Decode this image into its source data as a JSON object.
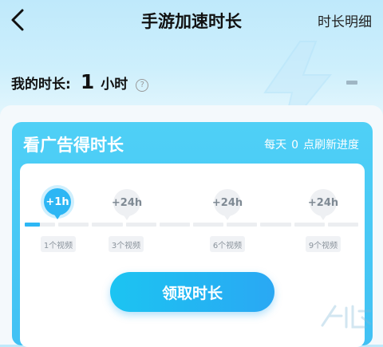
{
  "header": {
    "back_icon": "chevron-left-icon",
    "title": "手游加速时长",
    "detail_link": "时长明细"
  },
  "my_time": {
    "label": "我的时长:",
    "value": "1",
    "unit": "小时",
    "help_icon": "question-circle-icon",
    "help_glyph": "?"
  },
  "ad_card": {
    "title": "看广告得时长",
    "refresh_prefix": "每天",
    "refresh_count": "0",
    "refresh_suffix": "点刷新进度",
    "progress_fraction": 0.05,
    "milestones": [
      {
        "reward": "+1h",
        "requirement": "1个视频",
        "active": true
      },
      {
        "reward": "+24h",
        "requirement": "3个视频",
        "active": false
      },
      {
        "reward": "+24h",
        "requirement": "6个视频",
        "active": false
      },
      {
        "reward": "+24h",
        "requirement": "9个视频",
        "active": false
      }
    ],
    "claim_button": "领取时长"
  },
  "colors": {
    "accent": "#2cb6f4",
    "card_gradient_top": "#4fd0f6",
    "card_gradient_bottom": "#41c1f4",
    "inactive": "#eef0f3"
  }
}
